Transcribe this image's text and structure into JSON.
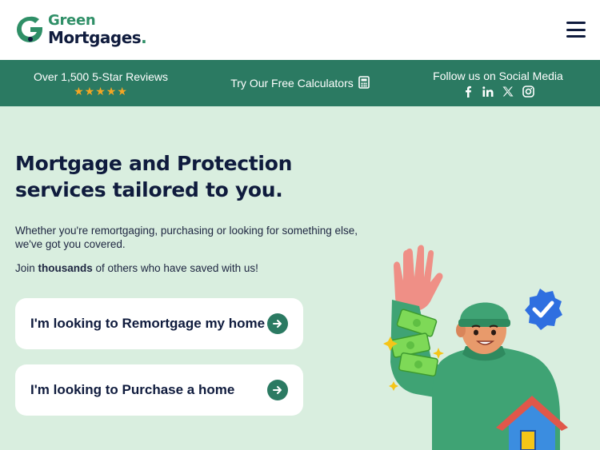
{
  "brand": {
    "name_top": "Green",
    "name_bottom": "Mortgages",
    "name_dot": ".",
    "primary_color": "#2b7a62",
    "accent_color": "#2f8f67",
    "navy": "#0f1b3d"
  },
  "header": {
    "menu_icon": "hamburger-menu-icon"
  },
  "infobar": {
    "reviews_text": "Over 1,500 5-Star Reviews",
    "stars": "★★★★★",
    "rating": 5,
    "calculators_text": "Try Our Free Calculators",
    "calculators_icon": "calculator-icon",
    "social_text": "Follow us on Social Media",
    "social_links": [
      {
        "icon": "facebook-icon",
        "glyph": "f"
      },
      {
        "icon": "linkedin-icon",
        "glyph": "in"
      },
      {
        "icon": "x-twitter-icon",
        "glyph": "𝕏"
      },
      {
        "icon": "instagram-icon",
        "glyph": ""
      }
    ]
  },
  "hero": {
    "title_line1": "Mortgage and Protection",
    "title_line2": "services tailored to you.",
    "subtitle": "Whether you're remortgaging, purchasing or looking for something else, we've got you covered.",
    "join_prefix": "Join ",
    "join_bold": "thousands",
    "join_suffix": " of others who have saved with us!",
    "cta_remortgage": "I'm looking to Remortgage my home",
    "cta_purchase": "I'm looking to Purchase a home",
    "cta_icon": "arrow-right-icon",
    "background": "#d9eedf"
  }
}
